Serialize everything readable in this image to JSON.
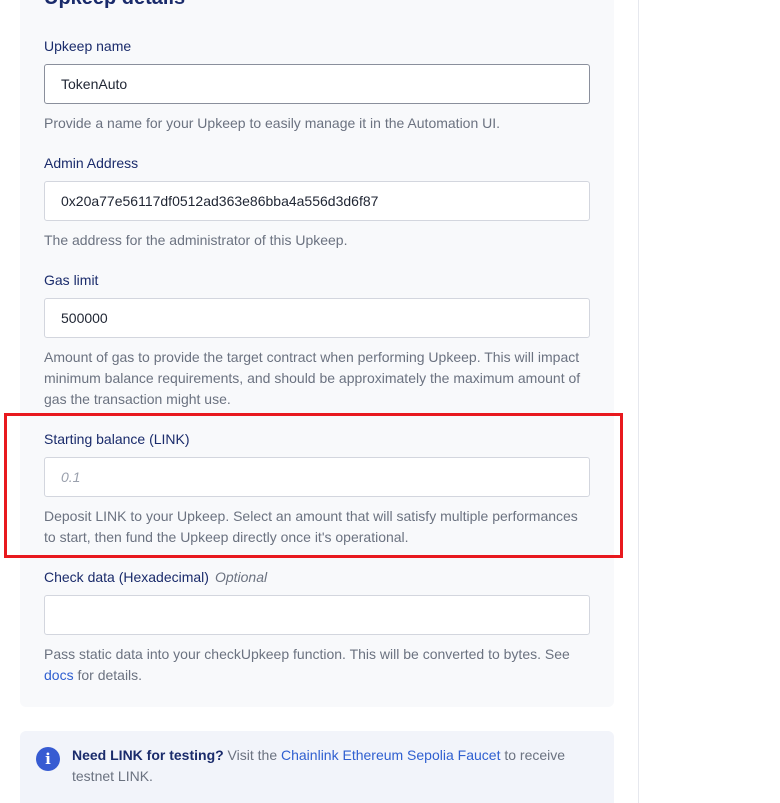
{
  "section": {
    "title": "Upkeep details"
  },
  "fields": {
    "upkeep_name": {
      "label": "Upkeep name",
      "value": "TokenAuto",
      "placeholder": "",
      "help": "Provide a name for your Upkeep to easily manage it in the Automation UI."
    },
    "admin_address": {
      "label": "Admin Address",
      "value": "0x20a77e56117df0512ad363e86bba4a556d3d6f87",
      "placeholder": "",
      "help": "The address for the administrator of this Upkeep."
    },
    "gas_limit": {
      "label": "Gas limit",
      "value": "500000",
      "placeholder": "",
      "help": "Amount of gas to provide the target contract when performing Upkeep. This will impact minimum balance requirements, and should be approximately the maximum amount of gas the transaction might use."
    },
    "starting_balance": {
      "label": "Starting balance (LINK)",
      "value": "",
      "placeholder": "0.1",
      "help": "Deposit LINK to your Upkeep. Select an amount that will satisfy multiple performances to start, then fund the Upkeep directly once it's operational."
    },
    "check_data": {
      "label": "Check data (Hexadecimal)",
      "optional_label": "Optional",
      "value": "",
      "placeholder": "",
      "help_before": "Pass static data into your checkUpkeep function. This will be converted to bytes. See ",
      "help_link": "docs",
      "help_after": " for details."
    }
  },
  "info": {
    "icon": "info-icon",
    "icon_glyph": "i",
    "bold": "Need LINK for testing?",
    "text_before": " Visit the ",
    "link": "Chainlink Ethereum Sepolia Faucet",
    "text_after": " to receive testnet LINK."
  },
  "colors": {
    "title": "#1a2b6b",
    "link": "#2f5fd0",
    "highlight": "#e8191e",
    "info_icon": "#375bd2"
  }
}
